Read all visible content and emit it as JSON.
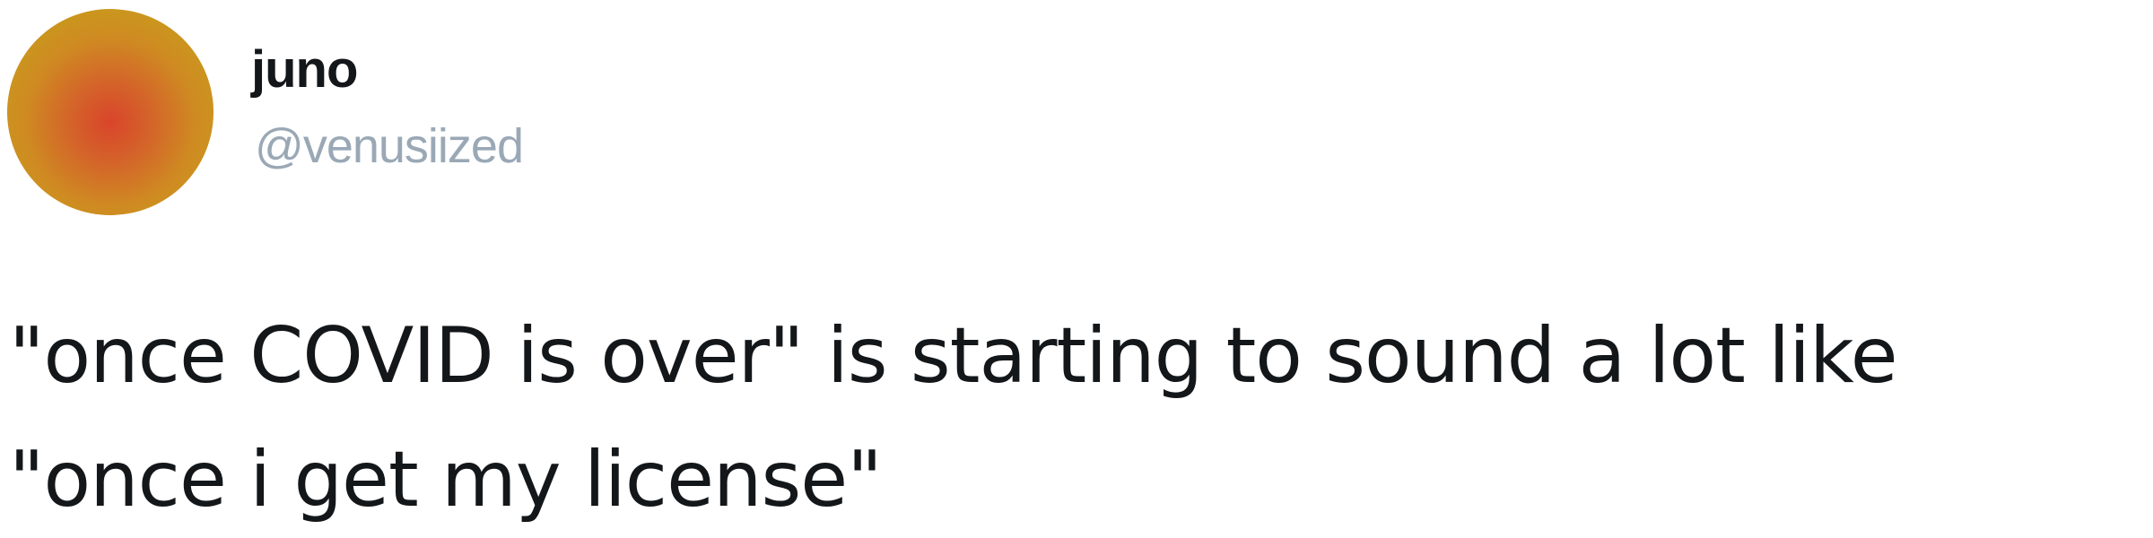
{
  "author": {
    "display_name": "juno",
    "handle": "@venusiized",
    "avatar_colors": {
      "center": "#d9452b",
      "edge": "#c69c1a"
    }
  },
  "tweet": {
    "lines": [
      "\"once COVID is over\" is starting to sound a lot like",
      "\"once i get my license\""
    ]
  }
}
